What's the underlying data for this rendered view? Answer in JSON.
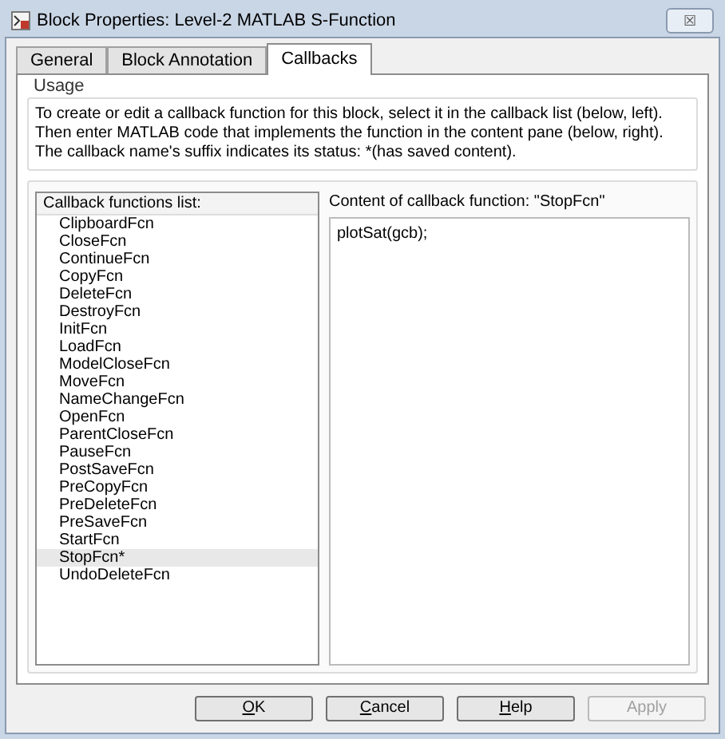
{
  "window": {
    "title": "Block Properties: Level-2 MATLAB S-Function",
    "close": "☒"
  },
  "tabs": [
    {
      "label": "General",
      "selected": false
    },
    {
      "label": "Block Annotation",
      "selected": false
    },
    {
      "label": "Callbacks",
      "selected": true
    }
  ],
  "usage": {
    "title": "Usage",
    "text": "To create or edit a callback function for this block, select it in the callback list (below, left). Then enter MATLAB code that implements the function in the content pane (below, right). The callback name's suffix indicates its status: *(has saved content)."
  },
  "callback_list": {
    "header": "Callback functions list:",
    "items": [
      {
        "label": "ClipboardFcn",
        "selected": false
      },
      {
        "label": "CloseFcn",
        "selected": false
      },
      {
        "label": "ContinueFcn",
        "selected": false
      },
      {
        "label": "CopyFcn",
        "selected": false
      },
      {
        "label": "DeleteFcn",
        "selected": false
      },
      {
        "label": "DestroyFcn",
        "selected": false
      },
      {
        "label": "InitFcn",
        "selected": false
      },
      {
        "label": "LoadFcn",
        "selected": false
      },
      {
        "label": "ModelCloseFcn",
        "selected": false
      },
      {
        "label": "MoveFcn",
        "selected": false
      },
      {
        "label": "NameChangeFcn",
        "selected": false
      },
      {
        "label": "OpenFcn",
        "selected": false
      },
      {
        "label": "ParentCloseFcn",
        "selected": false
      },
      {
        "label": "PauseFcn",
        "selected": false
      },
      {
        "label": "PostSaveFcn",
        "selected": false
      },
      {
        "label": "PreCopyFcn",
        "selected": false
      },
      {
        "label": "PreDeleteFcn",
        "selected": false
      },
      {
        "label": "PreSaveFcn",
        "selected": false
      },
      {
        "label": "StartFcn",
        "selected": false
      },
      {
        "label": "StopFcn*",
        "selected": true
      },
      {
        "label": "UndoDeleteFcn",
        "selected": false
      }
    ]
  },
  "content": {
    "label": "Content of callback function: \"StopFcn\"",
    "value": "plotSat(gcb);"
  },
  "buttons": [
    {
      "label": "OK",
      "disabled": false,
      "mnemonic": true
    },
    {
      "label": "Cancel",
      "disabled": false,
      "mnemonic": true
    },
    {
      "label": "Help",
      "disabled": false,
      "mnemonic": true
    },
    {
      "label": "Apply",
      "disabled": true,
      "mnemonic": false
    }
  ]
}
